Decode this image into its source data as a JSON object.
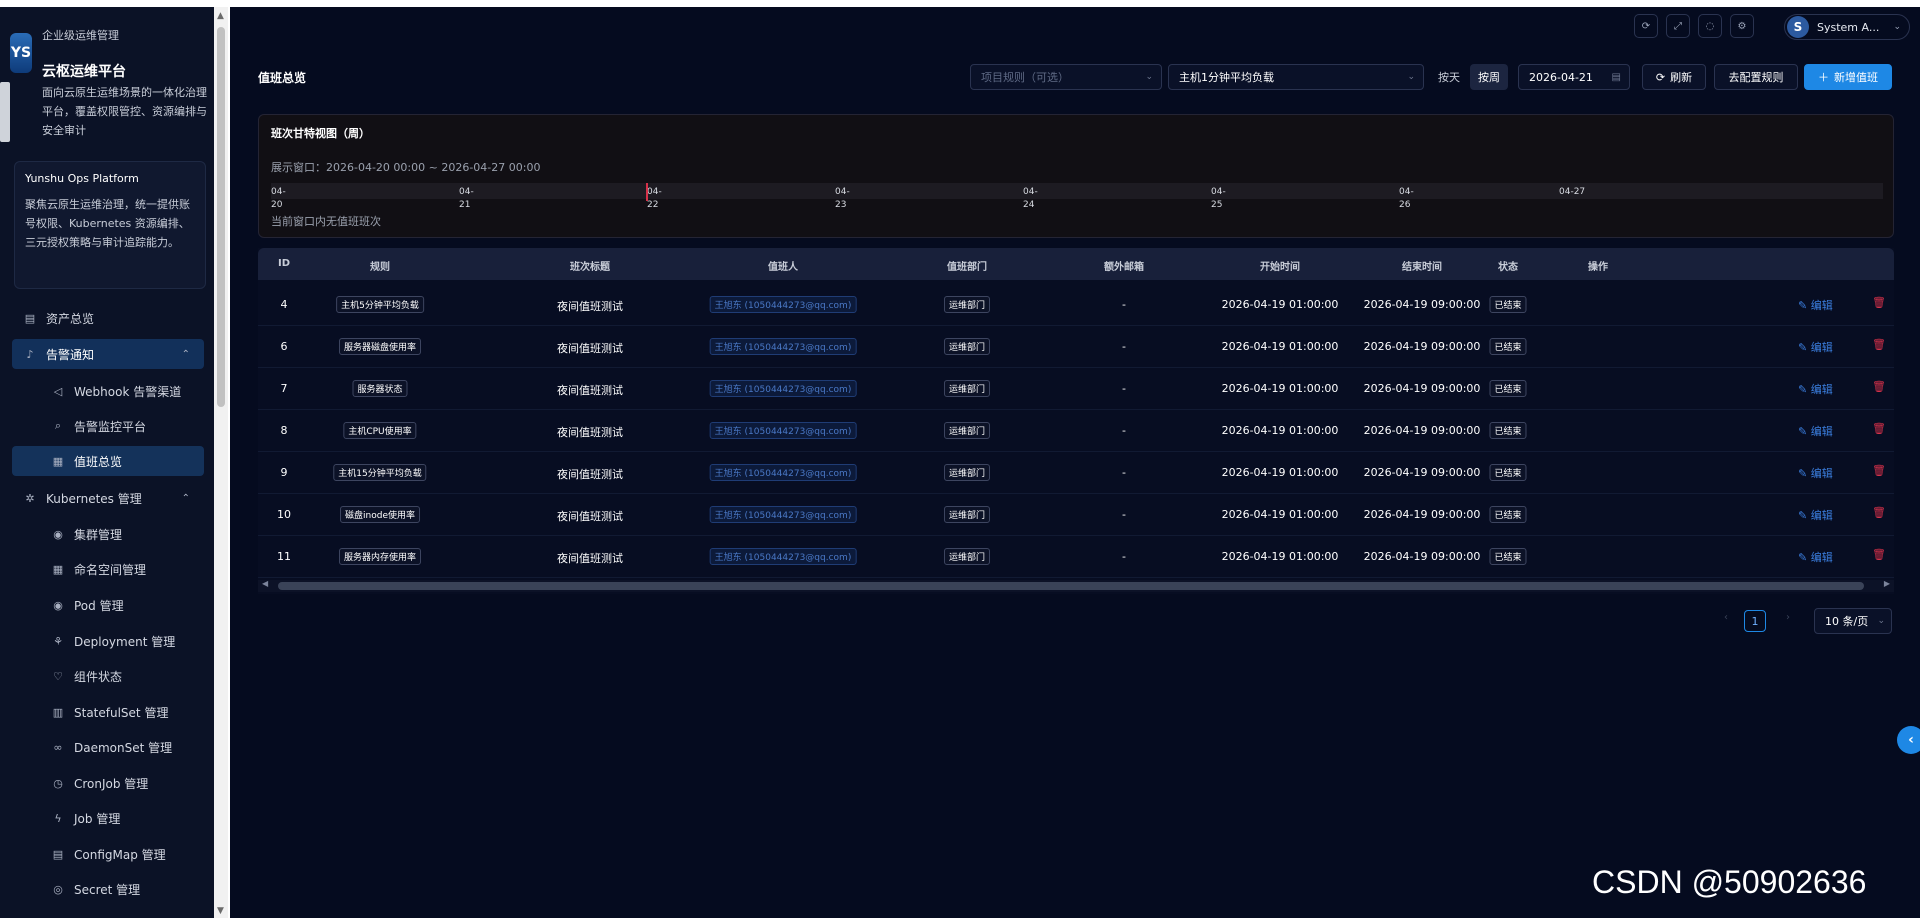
{
  "brand": {
    "logo": "YS",
    "small": "企业级运维管理",
    "title": "云枢运维平台",
    "desc": "面向云原生运维场景的一体化治理平台，覆盖权限管控、资源编排与安全审计"
  },
  "platform_card": {
    "title": "Yunshu Ops Platform",
    "desc": "聚焦云原生运维治理，统一提供账号权限、Kubernetes 资源编排、三元授权策略与审计追踪能力。"
  },
  "nav": [
    {
      "label": "资产总览",
      "icon": "list-icon"
    },
    {
      "label": "告警通知",
      "icon": "bell-icon"
    },
    {
      "label": "Webhook 告警渠道",
      "icon": "megaphone-icon"
    },
    {
      "label": "告警监控平台",
      "icon": "search-icon"
    },
    {
      "label": "值班总览",
      "icon": "calendar-icon"
    },
    {
      "label": "Kubernetes 管理",
      "icon": "cluster-icon"
    },
    {
      "label": "集群管理",
      "icon": "target-icon"
    },
    {
      "label": "命名空间管理",
      "icon": "grid-icon"
    },
    {
      "label": "Pod 管理",
      "icon": "target-icon"
    },
    {
      "label": "Deployment 管理",
      "icon": "deploy-icon"
    },
    {
      "label": "组件状态",
      "icon": "heart-icon"
    },
    {
      "label": "StatefulSet 管理",
      "icon": "stack-icon"
    },
    {
      "label": "DaemonSet 管理",
      "icon": "link-icon"
    },
    {
      "label": "CronJob 管理",
      "icon": "clock-icon"
    },
    {
      "label": "Job 管理",
      "icon": "bolt-icon"
    },
    {
      "label": "ConfigMap 管理",
      "icon": "file-icon"
    },
    {
      "label": "Secret 管理",
      "icon": "shield-icon"
    }
  ],
  "header": {
    "icons": [
      "refresh-icon",
      "fullscreen-icon",
      "bulb-icon",
      "settings-icon"
    ],
    "avatar": "S",
    "user": "System A..."
  },
  "toolbar": {
    "title": "值班总览",
    "project_placeholder": "项目规则（可选）",
    "rule_value": "主机1分钟平均负载",
    "by_day": "按天",
    "by_week": "按周",
    "date": "2026-04-21",
    "refresh": "刷新",
    "config_rule": "去配置规则",
    "new_shift": "新增值班"
  },
  "gantt": {
    "title": "班次甘特视图（周）",
    "window": "展示窗口：2026-04-20 00:00 ~ 2026-04-27 00:00",
    "ticks": [
      [
        "04-",
        "20"
      ],
      [
        "04-",
        "21"
      ],
      [
        "04-",
        "22"
      ],
      [
        "04-",
        "23"
      ],
      [
        "04-",
        "24"
      ],
      [
        "04-",
        "25"
      ],
      [
        "04-",
        "26"
      ],
      [
        "04-27",
        ""
      ]
    ],
    "empty": "当前窗口内无值班班次"
  },
  "table": {
    "headers": [
      "ID",
      "规则",
      "班次标题",
      "值班人",
      "值班部门",
      "额外邮箱",
      "开始时间",
      "结束时间",
      "状态",
      "操作"
    ],
    "rows": [
      {
        "id": "4",
        "rule": "主机5分钟平均负载",
        "title": "夜间值班测试",
        "person": "王旭东 (1050444273@qq.com)",
        "dept": "运维部门",
        "email": "-",
        "start": "2026-04-19 01:00:00",
        "end": "2026-04-19 09:00:00",
        "status": "已结束"
      },
      {
        "id": "6",
        "rule": "服务器磁盘使用率",
        "title": "夜间值班测试",
        "person": "王旭东 (1050444273@qq.com)",
        "dept": "运维部门",
        "email": "-",
        "start": "2026-04-19 01:00:00",
        "end": "2026-04-19 09:00:00",
        "status": "已结束"
      },
      {
        "id": "7",
        "rule": "服务器状态",
        "title": "夜间值班测试",
        "person": "王旭东 (1050444273@qq.com)",
        "dept": "运维部门",
        "email": "-",
        "start": "2026-04-19 01:00:00",
        "end": "2026-04-19 09:00:00",
        "status": "已结束"
      },
      {
        "id": "8",
        "rule": "主机CPU使用率",
        "title": "夜间值班测试",
        "person": "王旭东 (1050444273@qq.com)",
        "dept": "运维部门",
        "email": "-",
        "start": "2026-04-19 01:00:00",
        "end": "2026-04-19 09:00:00",
        "status": "已结束"
      },
      {
        "id": "9",
        "rule": "主机15分钟平均负载",
        "title": "夜间值班测试",
        "person": "王旭东 (1050444273@qq.com)",
        "dept": "运维部门",
        "email": "-",
        "start": "2026-04-19 01:00:00",
        "end": "2026-04-19 09:00:00",
        "status": "已结束"
      },
      {
        "id": "10",
        "rule": "磁盘inode使用率",
        "title": "夜间值班测试",
        "person": "王旭东 (1050444273@qq.com)",
        "dept": "运维部门",
        "email": "-",
        "start": "2026-04-19 01:00:00",
        "end": "2026-04-19 09:00:00",
        "status": "已结束"
      },
      {
        "id": "11",
        "rule": "服务器内存使用率",
        "title": "夜间值班测试",
        "person": "王旭东 (1050444273@qq.com)",
        "dept": "运维部门",
        "email": "-",
        "start": "2026-04-19 01:00:00",
        "end": "2026-04-19 09:00:00",
        "status": "已结束"
      }
    ],
    "edit_label": "编辑",
    "delete_icon": "trash-icon"
  },
  "pagination": {
    "current": "1",
    "page_size": "10 条/页"
  },
  "watermark": "CSDN @50902636",
  "colors": {
    "background": "#050b1f",
    "sidebar": "#0b1226",
    "accent": "#1e88e5",
    "danger": "#d6314a",
    "link": "#3b7fe0"
  }
}
